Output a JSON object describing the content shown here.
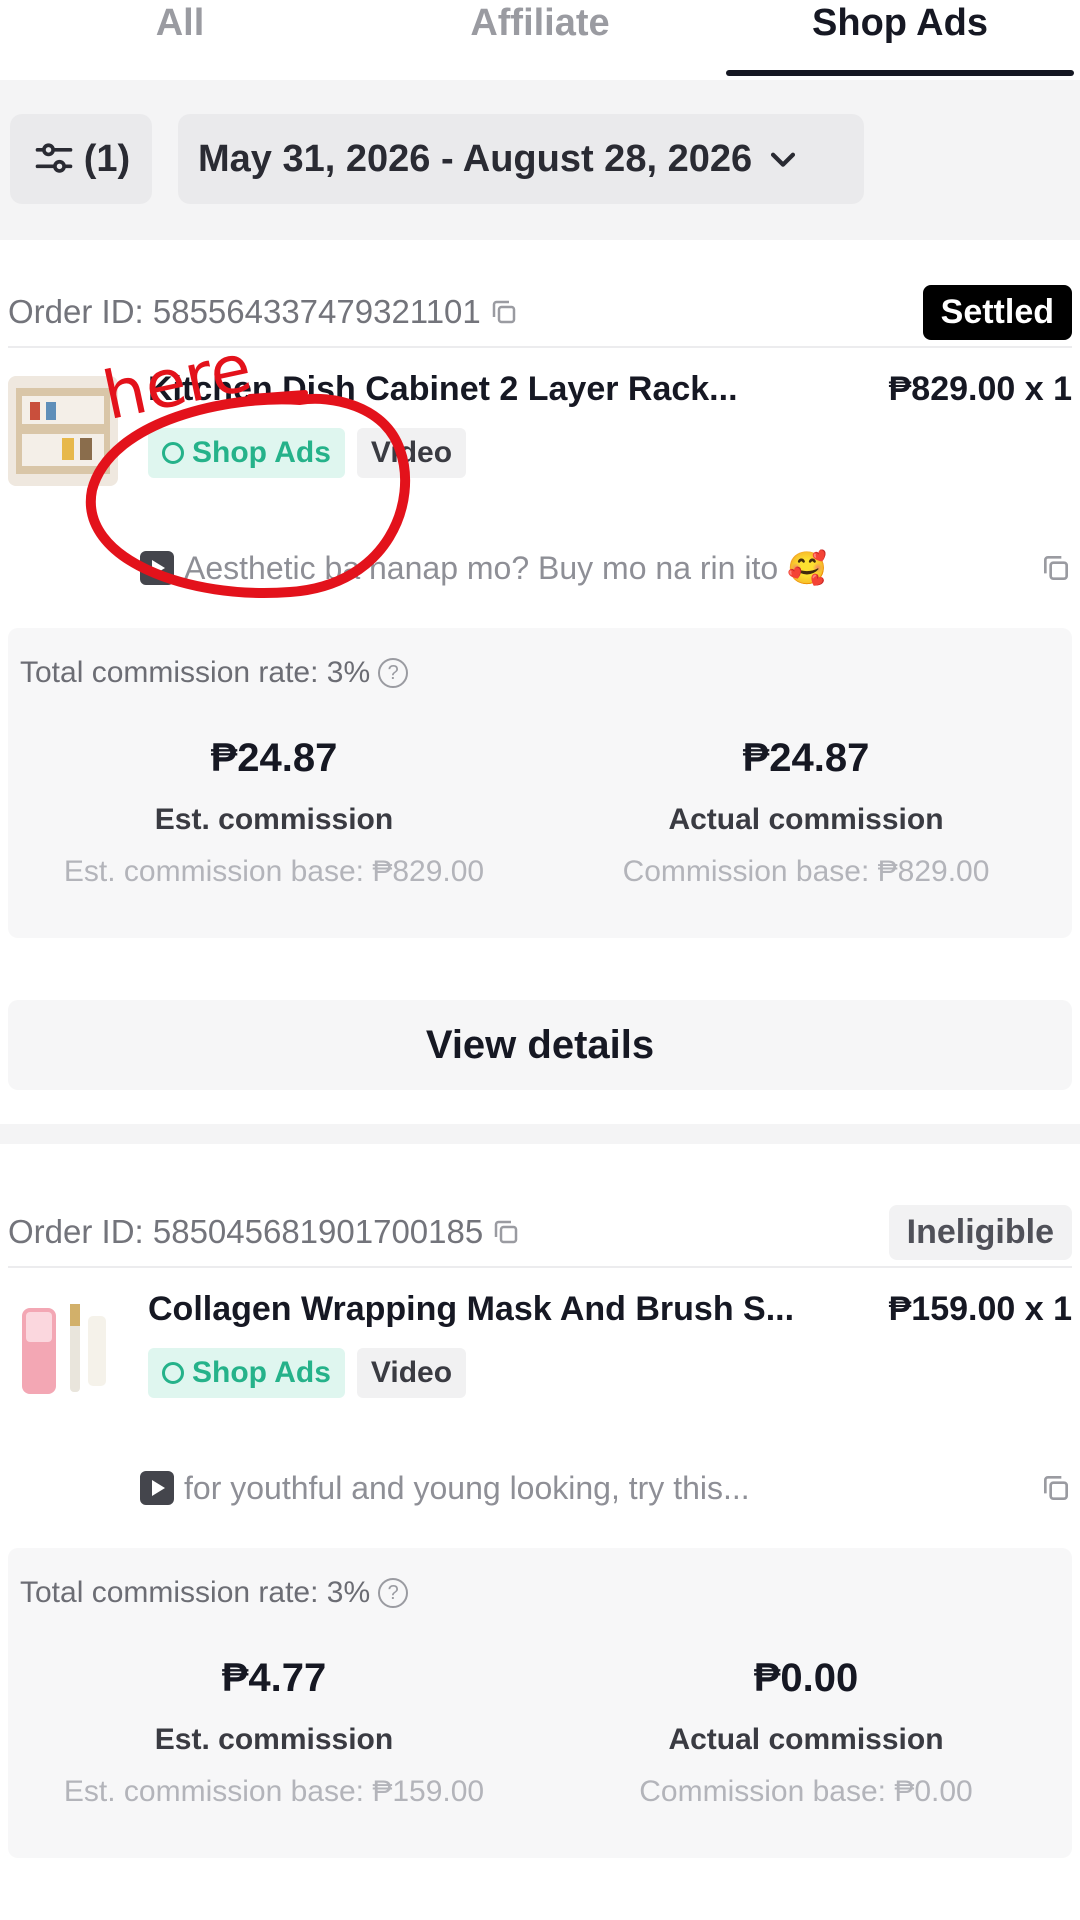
{
  "tabs": [
    {
      "label": "All"
    },
    {
      "label": "Affiliate"
    },
    {
      "label": "Shop Ads"
    }
  ],
  "filters": {
    "filter_label": "(1)",
    "date_range": "May 31, 2026 - August 28, 2026"
  },
  "orders": [
    {
      "order_id": "Order ID: 585564337479321101",
      "status": "Settled",
      "product_name": "Kitchen Dish Cabinet 2 Layer Rack...",
      "price": "₱829.00 x 1",
      "tags": [
        "Shop Ads",
        "Video"
      ],
      "caption": "Aesthetic ba hanap mo? Buy mo na rin ito 🥰",
      "rate": "Total commission rate: 3%",
      "est_amount": "₱24.87",
      "est_label": "Est. commission",
      "est_base": "Est. commission base: ₱829.00",
      "actual_amount": "₱24.87",
      "actual_label": "Actual commission",
      "actual_base": "Commission base: ₱829.00"
    },
    {
      "order_id": "Order ID: 585045681901700185",
      "status": "Ineligible",
      "product_name": "Collagen Wrapping Mask And Brush S...",
      "price": "₱159.00 x 1",
      "tags": [
        "Shop Ads",
        "Video"
      ],
      "caption": "for youthful and young looking, try this...",
      "rate": "Total commission rate: 3%",
      "est_amount": "₱4.77",
      "est_label": "Est. commission",
      "est_base": "Est. commission base: ₱159.00",
      "actual_amount": "₱0.00",
      "actual_label": "Actual commission",
      "actual_base": "Commission base: ₱0.00"
    }
  ],
  "view_details": "View details",
  "annotation": {
    "text": "here",
    "color": "#e3121b"
  },
  "colors": {
    "accent_green": "#25b28a",
    "settled_bg": "#000000"
  }
}
